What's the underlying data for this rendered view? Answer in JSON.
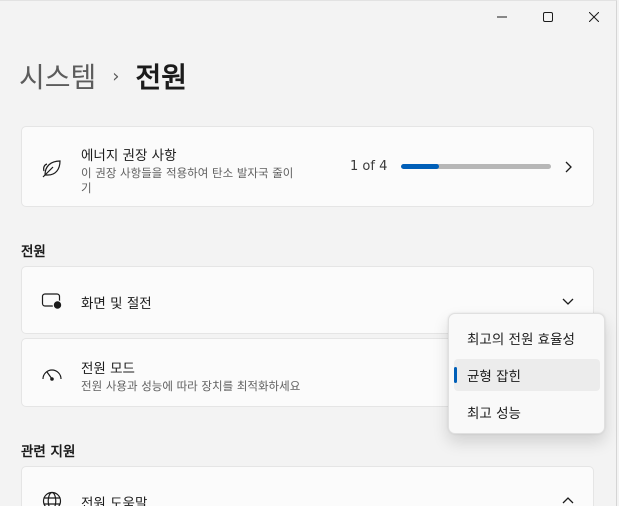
{
  "window": {
    "minimize_icon": "minimize-icon",
    "maximize_icon": "maximize-icon",
    "close_icon": "close-icon"
  },
  "breadcrumb": {
    "parent": "시스템",
    "separator": "›",
    "current": "전원"
  },
  "energy_card": {
    "icon": "leaf-icon",
    "title": "에너지 권장 사항",
    "description_line1": "이 권장 사항들을 적용하여 탄소 발자국 줄이",
    "description_line2": "기",
    "progress_text": "1 of 4",
    "progress_value": 0.25,
    "chevron_icon": "chevron-right-icon"
  },
  "power_section": {
    "label": "전원",
    "screen_sleep": {
      "icon": "screen-sleep-icon",
      "title": "화면 및 절전",
      "chevron_icon": "chevron-down-icon"
    },
    "power_mode": {
      "icon": "speedometer-icon",
      "title": "전원 모드",
      "description": "전원 사용과 성능에 따라 장치를 최적화하세요"
    }
  },
  "power_mode_flyout": {
    "options": [
      {
        "label": "최고의 전원 효율성",
        "selected": false
      },
      {
        "label": "균형 잡힌",
        "selected": true
      },
      {
        "label": "최고 성능",
        "selected": false
      }
    ]
  },
  "related_section": {
    "label": "관련 지원",
    "help": {
      "icon": "globe-icon",
      "title": "전원 도움말",
      "chevron_icon": "chevron-up-icon"
    }
  },
  "colors": {
    "accent": "#005fb8",
    "background": "#f3f3f3",
    "card": "#fbfbfb"
  }
}
